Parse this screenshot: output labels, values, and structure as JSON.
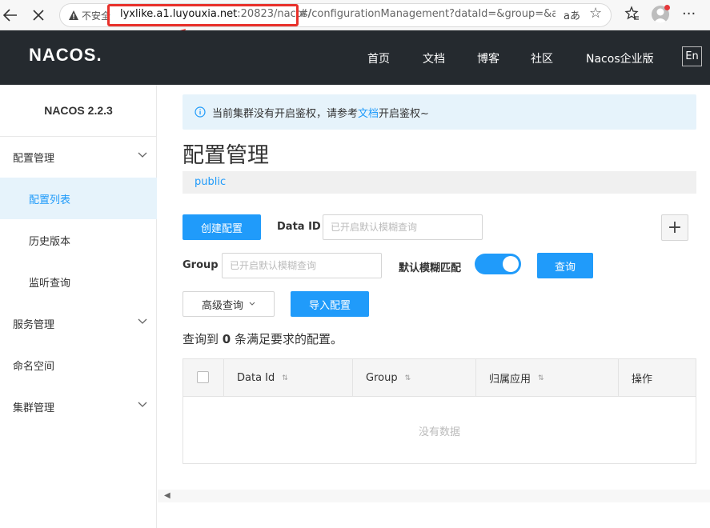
{
  "browser": {
    "insecure_label": "不安全",
    "url_host": "lyxlike.a1.luyouxia.net",
    "url_port_path": ":20823/nacos/",
    "url_rest": "#/configurationManagement?dataId=&group=&a...",
    "read_aloud_label": "aあ"
  },
  "header": {
    "logo": "NACOS.",
    "nav": [
      "首页",
      "文档",
      "博客",
      "社区",
      "Nacos企业版"
    ],
    "lang_button": "En"
  },
  "sidebar": {
    "title": "NACOS 2.2.3",
    "items": [
      {
        "label": "配置管理",
        "level": "top",
        "expandable": true
      },
      {
        "label": "配置列表",
        "level": "sub",
        "active": true
      },
      {
        "label": "历史版本",
        "level": "sub"
      },
      {
        "label": "监听查询",
        "level": "sub"
      },
      {
        "label": "服务管理",
        "level": "top",
        "expandable": true
      },
      {
        "label": "命名空间",
        "level": "top"
      },
      {
        "label": "集群管理",
        "level": "top",
        "expandable": true
      }
    ]
  },
  "notice": {
    "text_before": "当前集群没有开启鉴权，请参考",
    "link_text": "文档",
    "text_after": "开启鉴权~"
  },
  "page_title": "配置管理",
  "namespace": {
    "active": "public"
  },
  "toolbar": {
    "create_label": "创建配置",
    "dataid_label": "Data ID",
    "dataid_placeholder": "已开启默认模糊查询",
    "group_label": "Group",
    "group_placeholder": "已开启默认模糊查询",
    "fuzzy_label": "默认模糊匹配",
    "fuzzy_enabled": true,
    "query_label": "查询",
    "advanced_label": "高级查询",
    "import_label": "导入配置",
    "plus_label": "+"
  },
  "result": {
    "prefix": "查询到 ",
    "count": "0",
    "suffix": " 条满足要求的配置。"
  },
  "table": {
    "columns": [
      "Data Id",
      "Group",
      "归属应用",
      "操作"
    ],
    "empty_text": "没有数据"
  },
  "colors": {
    "accent": "#209bfa",
    "header_bg": "#252a2f",
    "highlight_red": "#e8302a"
  }
}
